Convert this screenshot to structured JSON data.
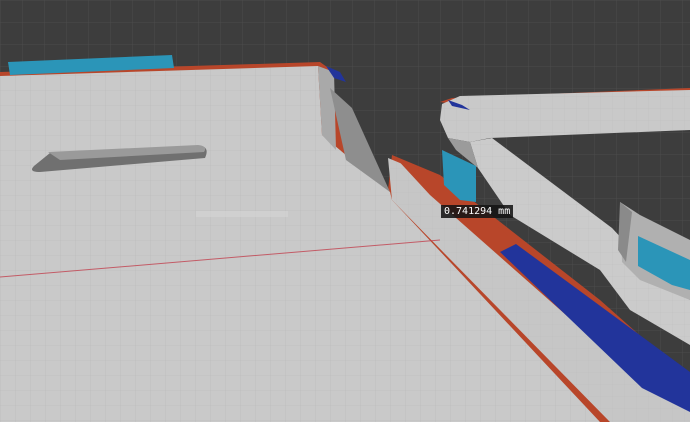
{
  "viewport": {
    "measurement": {
      "value": "0.741294 mm"
    },
    "colors": {
      "background": "#3d3d3d",
      "grid": "#4b4b4b",
      "surface": "#c9c9c9",
      "surface_shade": "#a9a9a9",
      "surface_dark": "#8e8e8e",
      "edge_selected": "#b8462a",
      "face_highlight": "#2b95b8",
      "face_dark_blue": "#22349b",
      "x_axis": "#c2404e"
    }
  }
}
